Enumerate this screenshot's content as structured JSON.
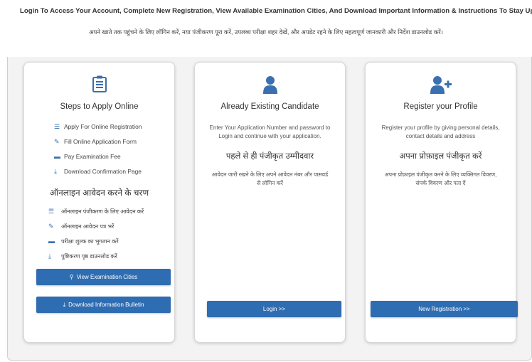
{
  "header": {
    "headline_en": "Login To Access Your Account, Complete New Registration, View Available Examination Cities, And Download Important Information & Instructions To Stay Updated.",
    "headline_hi": "अपने खाते तक पहुंचने के लिए लॉगिन करें, नया पंजीकरण पूरा करें, उपलब्ध परीक्षा शहर देखें, और अपडेट रहने के लिए महत्वपूर्ण जानकारी और निर्देश डाउनलोड करें।"
  },
  "steps_card": {
    "title": "Steps to Apply Online",
    "steps": [
      "Apply For Online Registration",
      "Fill Online Application Form",
      "Pay Examination Fee",
      "Download Confirmation Page"
    ],
    "title_hi": "ऑनलाइन आवेदन करने के चरण",
    "steps_hi": [
      "ऑनलाइन पंजीकरण के लिए आवेदन करें",
      "ऑनलाइन आवेदन पत्र भरें",
      "परीक्षा शुल्क का भुगतान करें",
      "पुष्टिकरण पृष्ठ डाउनलोड करें"
    ],
    "cities_button": "View Examination Cities",
    "bulletin_button": "Download Information Bulletin"
  },
  "existing_card": {
    "title": "Already Existing Candidate",
    "desc": "Enter Your Application Number and password to Login and continue with your application.",
    "title_hi": "पहले से ही पंजीकृत उम्मीदवार",
    "desc_hi": "आवेदन जारी रखने के लिए अपने आवेदन नंबर और पासवर्ड से लॉगिन करें",
    "button": "Login >>"
  },
  "register_card": {
    "title": "Register your Profile",
    "desc": "Register your profile by giving personal details, contact details and address",
    "title_hi": "अपना प्रोफ़ाइल पंजीकृत करें",
    "desc_hi": "अपना प्रोफ़ाइल पंजीकृत करने के लिए व्यक्तिगत विवरण, संपर्क विवरण और पता दें",
    "button": "New Registration >>"
  },
  "colors": {
    "accent": "#2f6db2",
    "icon": "#3a6fb0"
  }
}
